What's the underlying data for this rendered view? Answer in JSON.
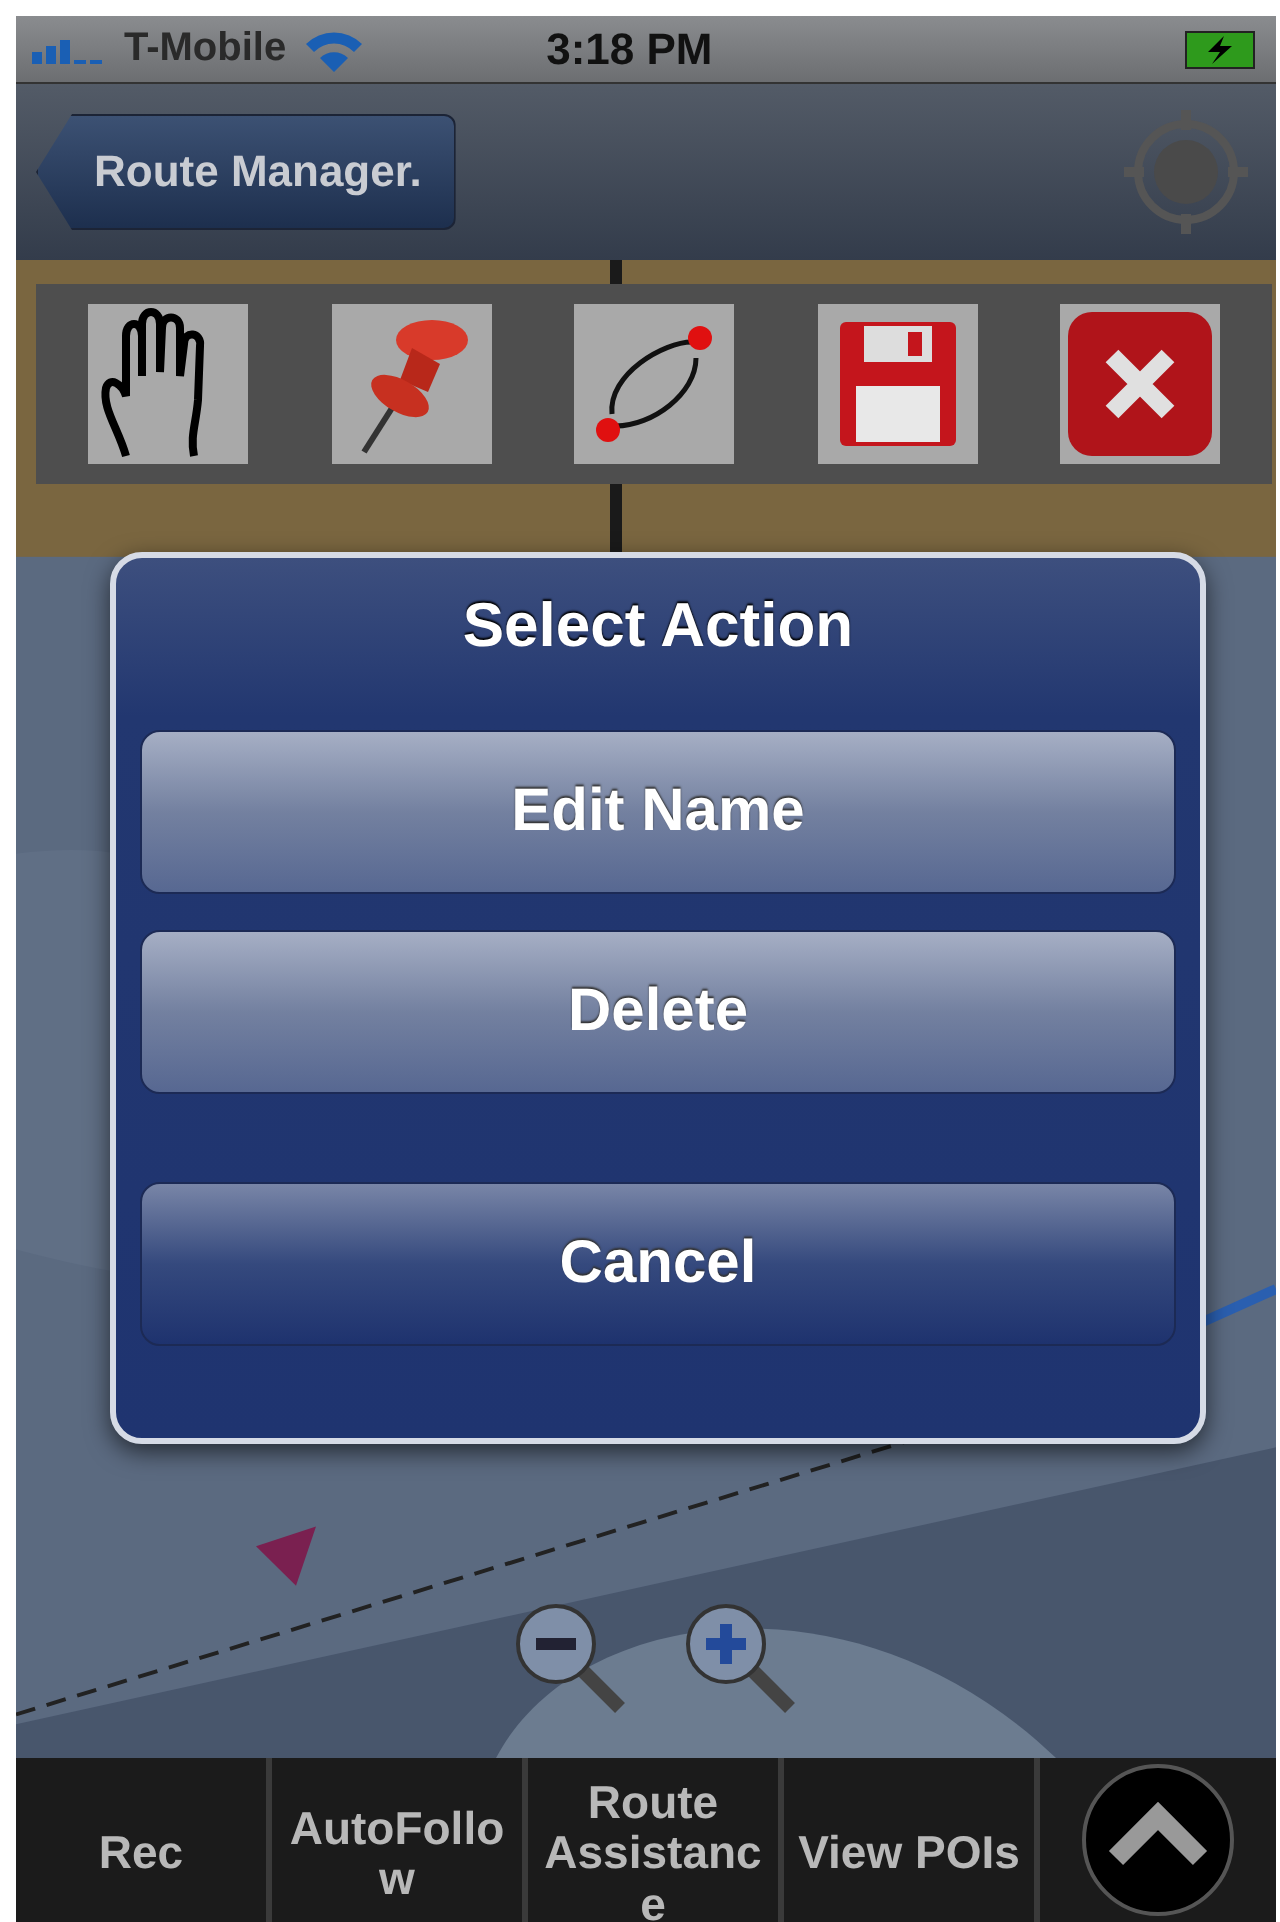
{
  "status_bar": {
    "carrier": "T-Mobile",
    "time": "3:18 PM"
  },
  "nav_bar": {
    "back_button": "Route Manager."
  },
  "toolbar": {
    "tools": [
      {
        "kind": "hand"
      },
      {
        "kind": "pin"
      },
      {
        "kind": "route"
      },
      {
        "kind": "save"
      },
      {
        "kind": "close"
      }
    ]
  },
  "dialog": {
    "title": "Select Action",
    "buttons": [
      {
        "label": "Edit Name",
        "kind": "action"
      },
      {
        "label": "Delete",
        "kind": "action"
      },
      {
        "label": "Cancel",
        "kind": "cancel"
      }
    ]
  },
  "bottom_bar": {
    "items": [
      {
        "label": "Rec"
      },
      {
        "label": "AutoFollow"
      },
      {
        "label": "Route Assistance"
      },
      {
        "label": "View POIs"
      }
    ]
  }
}
